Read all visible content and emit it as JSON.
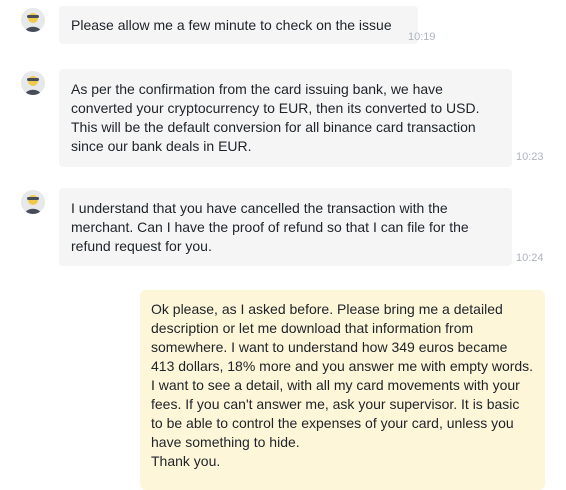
{
  "messages": [
    {
      "sender": "agent",
      "lines": [
        "Please allow me a few minute to check on the issue"
      ],
      "time": "10:19"
    },
    {
      "sender": "agent",
      "lines": [
        "As per the confirmation from the card issuing bank, we have",
        "converted your cryptocurrency to EUR, then its converted to USD.",
        "This will be the default conversion for all binance card transaction",
        "since our bank deals in EUR."
      ],
      "time": "10:23"
    },
    {
      "sender": "agent",
      "lines": [
        "I understand that you have cancelled the transaction with the",
        "merchant. Can I have the proof of refund so that I can file for the",
        "refund request for you."
      ],
      "time": "10:24"
    },
    {
      "sender": "user",
      "lines": [
        "Ok please, as I asked before. Please bring me a detailed",
        "description or let me download that information from",
        "somewhere. I want to understand how 349 euros became",
        "413 dollars, 18% more and you answer me with empty words.",
        "I want to see a detail, with all my card movements with your",
        "fees. If you can't answer me, ask your supervisor. It is basic",
        "to be able to control the expenses of your card, unless you",
        "have something to hide.",
        "Thank you."
      ]
    }
  ],
  "icons": {
    "agent_avatar": "support-agent-avatar-icon"
  },
  "colors": {
    "agent_bubble": "#f5f5f5",
    "user_bubble": "#fef6d8",
    "timestamp": "#aeb4bc",
    "text": "#1e2329"
  }
}
